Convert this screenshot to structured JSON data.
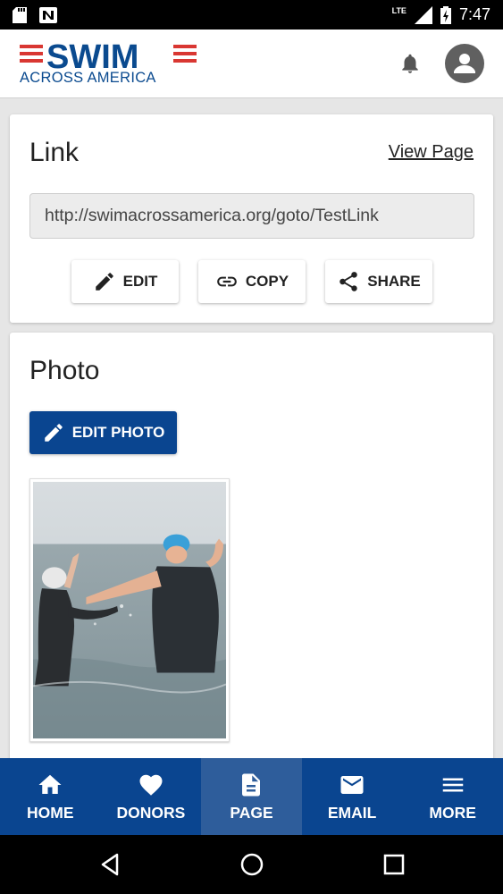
{
  "status_bar": {
    "time": "7:47",
    "network": "LTE"
  },
  "header": {
    "logo_main": "SWIM",
    "logo_sub": "ACROSS AMERICA"
  },
  "link_card": {
    "title": "Link",
    "view_page_label": "View Page",
    "url": "http://swimacrossamerica.org/goto/TestLink",
    "buttons": {
      "edit": "EDIT",
      "copy": "COPY",
      "share": "SHARE"
    }
  },
  "photo_card": {
    "title": "Photo",
    "edit_photo_label": "EDIT PHOTO"
  },
  "bottom_nav": {
    "items": [
      {
        "label": "HOME",
        "icon": "home-icon"
      },
      {
        "label": "DONORS",
        "icon": "heart-icon"
      },
      {
        "label": "PAGE",
        "icon": "page-icon",
        "active": true
      },
      {
        "label": "EMAIL",
        "icon": "email-icon"
      },
      {
        "label": "MORE",
        "icon": "menu-icon"
      }
    ]
  },
  "colors": {
    "brand_blue": "#0a4590",
    "brand_red": "#d93732",
    "active_tab": "#2e5d9b"
  }
}
